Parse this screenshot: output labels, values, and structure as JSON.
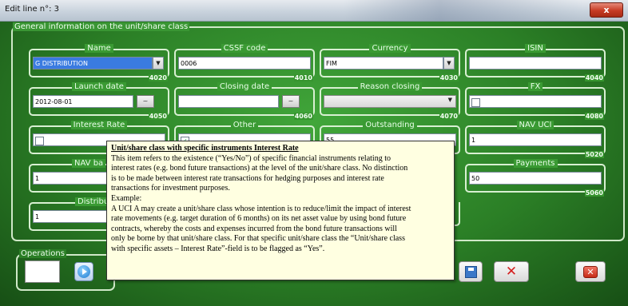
{
  "window": {
    "title": "Edit line n°: 3",
    "close_label": "x"
  },
  "general_group": {
    "title": "General information on the unit/share class"
  },
  "fields": {
    "name": {
      "label": "Name",
      "value": "G DISTRIBUTION",
      "code": "4020"
    },
    "cssf_code": {
      "label": "CSSF code",
      "value": "0006",
      "code": "4010"
    },
    "currency": {
      "label": "Currency",
      "value": "FIM",
      "code": "4030"
    },
    "isin": {
      "label": "ISIN",
      "value": "",
      "code": "4040"
    },
    "launch_date": {
      "label": "Launch date",
      "value": "2012-08-01",
      "code": "4050"
    },
    "closing_date": {
      "label": "Closing date",
      "value": "",
      "code": "4060"
    },
    "reason_closing": {
      "label": "Reason closing",
      "value": "",
      "code": "4070"
    },
    "fx": {
      "label": "FX",
      "checked": false,
      "code": "4080"
    },
    "interest_rate": {
      "label": "Interest Rate",
      "checked": false
    },
    "other": {
      "label": "Other",
      "checked": true
    },
    "outstanding": {
      "label": "Outstanding",
      "value": "55"
    },
    "nav_uci": {
      "label": "NAV UCI",
      "value": "1",
      "code": "5020"
    },
    "nav_ba": {
      "label": "NAV ba",
      "value": "1"
    },
    "payments": {
      "label": "Payments",
      "value": "50",
      "code": "5060"
    },
    "distribution": {
      "label": "Distributi",
      "value": "1"
    }
  },
  "operations": {
    "title": "Operations"
  },
  "tooltip": {
    "title": "Unit/share class with specific instruments Interest Rate",
    "line1": "This item refers to the existence (“Yes/No”) of specific financial instruments relating to",
    "line2": "interest rates (e.g. bond future transactions) at the level of the unit/share class. No distinction",
    "line3": "is to be made between interest rate transactions for hedging purposes and interest rate",
    "line4": "transactions for investment purposes.",
    "line5": "Example:",
    "line6": "A UCI A may create a unit/share class whose intention is to reduce/limit the impact of interest",
    "line7": "rate movements (e.g. target duration of 6 months) on its net asset value by using bond future",
    "line8": "contracts, whereby the costs and expenses incurred from the bond future transactions will",
    "line9": "only be borne by that unit/share class. For that specific unit/share class the “Unit/share class",
    "line10": "with specific assets – Interest Rate”-field is to be flagged as “Yes”."
  },
  "icons": {
    "dropdown": "chevron-down-icon",
    "calendar": "calendar-icon",
    "play": "play-icon",
    "save": "save-icon",
    "delete": "delete-icon",
    "close": "close-icon"
  },
  "colors": {
    "background": "#2b7f26",
    "tooltip_bg": "#ffffe1",
    "selection": "#3a7be0",
    "danger": "#d31f1f"
  }
}
